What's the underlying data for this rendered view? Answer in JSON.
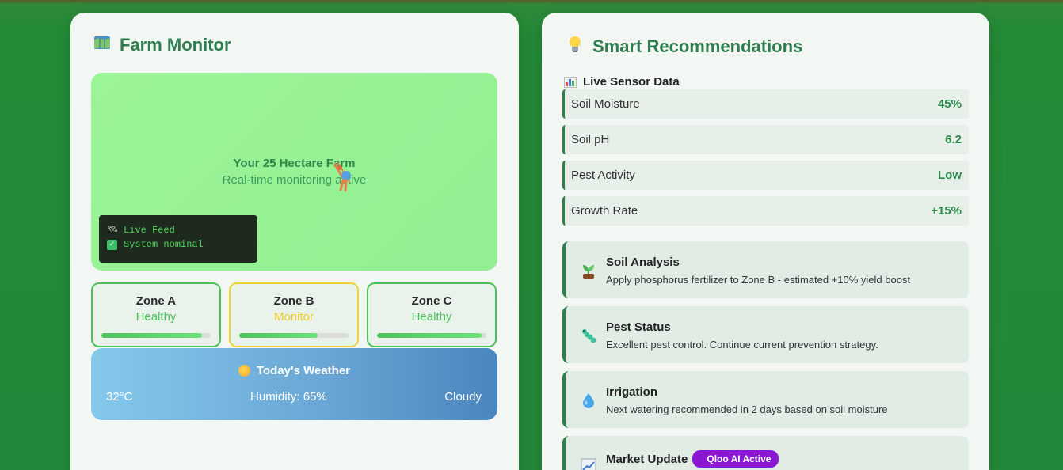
{
  "farm_monitor": {
    "title": "Farm Monitor",
    "title_icon": "map-icon",
    "map": {
      "title": "Your 25 Hectare Farm",
      "subtitle": "Real-time monitoring active",
      "live_feed": {
        "line1": "Live Feed",
        "line2": "System nominal"
      }
    },
    "zones": [
      {
        "name": "Zone A",
        "status": "Healthy",
        "progress": 0.92,
        "color": "#4cc25a"
      },
      {
        "name": "Zone B",
        "status": "Monitor",
        "progress": 0.72,
        "color": "#efcc23"
      },
      {
        "name": "Zone C",
        "status": "Healthy",
        "progress": 0.96,
        "color": "#4cc25a"
      }
    ],
    "weather": {
      "title": "Today's Weather",
      "temperature": "32°C",
      "humidity": "Humidity: 65%",
      "condition": "Cloudy"
    }
  },
  "recommendations": {
    "title": "Smart Recommendations",
    "title_icon": "lightbulb-icon",
    "sensor_heading": "Live Sensor Data",
    "sensors": [
      {
        "label": "Soil Moisture",
        "value": "45%"
      },
      {
        "label": "Soil pH",
        "value": "6.2"
      },
      {
        "label": "Pest Activity",
        "value": "Low"
      },
      {
        "label": "Growth Rate",
        "value": "+15%"
      }
    ],
    "cards": [
      {
        "title": "Soil Analysis",
        "text": "Apply phosphorus fertilizer to Zone B - estimated +10% yield boost",
        "icon": "seedling-icon"
      },
      {
        "title": "Pest Status",
        "text": "Excellent pest control. Continue current prevention strategy.",
        "icon": "bug-icon"
      },
      {
        "title": "Irrigation",
        "text": "Next watering recommended in 2 days based on soil moisture",
        "icon": "droplet-icon"
      },
      {
        "title": "Market Update",
        "text": "",
        "icon": "trend-chart-icon",
        "badge": "Qloo AI Active"
      }
    ]
  },
  "colors": {
    "accent": "#2e7d4f",
    "healthy": "#4cc25a",
    "monitor": "#efcc23",
    "badge": "#8a17d3"
  }
}
